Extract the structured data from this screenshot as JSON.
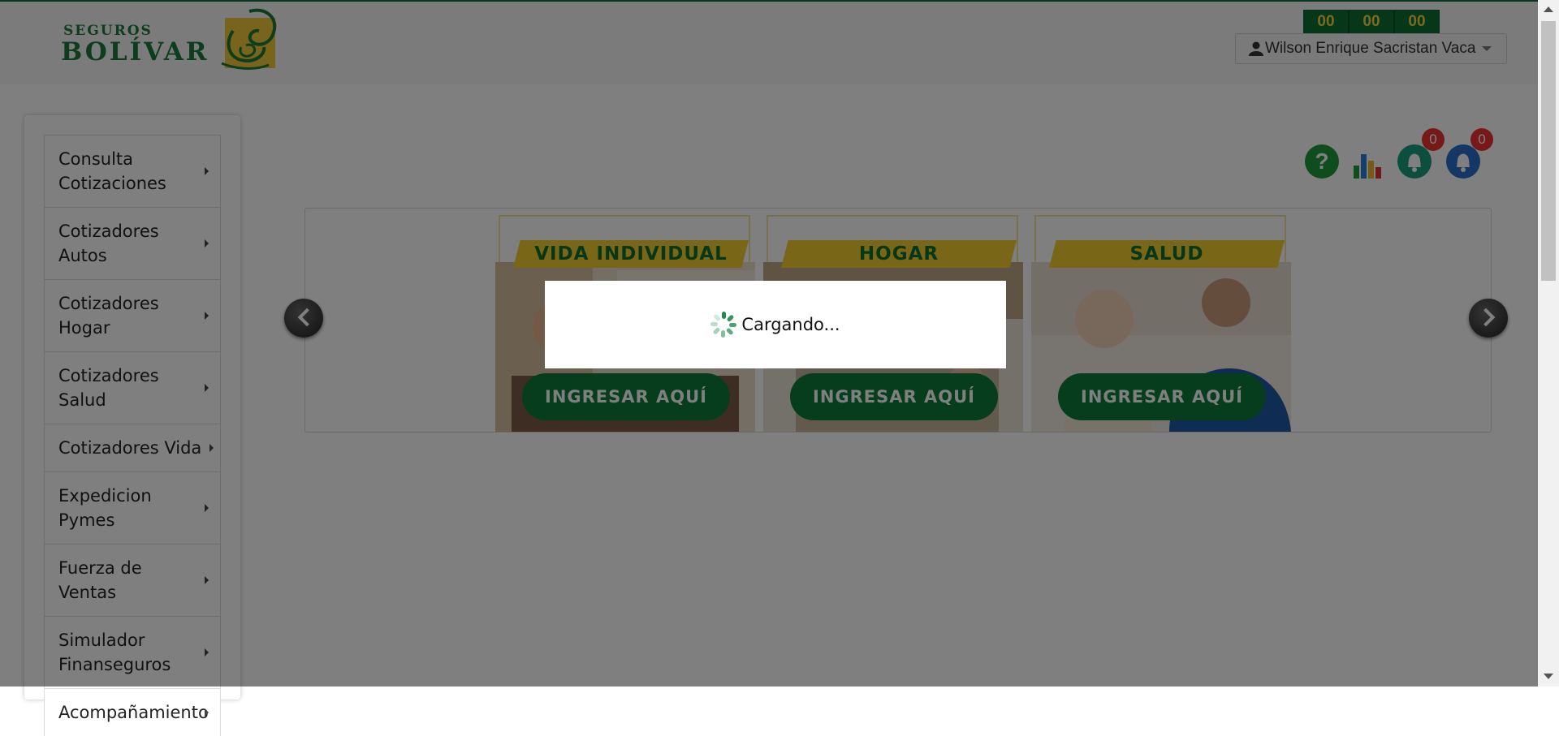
{
  "brand": {
    "line1": "SEGUROS",
    "line2": "BOLÍVAR"
  },
  "timer": [
    "00",
    "00",
    "00"
  ],
  "user": {
    "name": "Wilson Enrique Sacristan Vaca"
  },
  "header_icons": {
    "help": "help-icon",
    "stats": "bar-chart-icon",
    "notifications_green": {
      "icon": "bell-icon",
      "count": "0"
    },
    "notifications_blue": {
      "icon": "bell-icon",
      "count": "0"
    }
  },
  "menu": [
    {
      "line1": "Consulta",
      "line2": "Cotizaciones"
    },
    {
      "line1": "Cotizadores",
      "line2": "Autos"
    },
    {
      "line1": "Cotizadores",
      "line2": "Hogar"
    },
    {
      "line1": "Cotizadores",
      "line2": "Salud"
    },
    {
      "line1": "Cotizadores Vida",
      "line2": ""
    },
    {
      "line1": "Expedicion",
      "line2": "Pymes"
    },
    {
      "line1": "Fuerza de",
      "line2": "Ventas"
    },
    {
      "line1": "Simulador",
      "line2": "Finanseguros"
    },
    {
      "line1": "Acompañamiento",
      "line2": ""
    }
  ],
  "carousel": {
    "cards": [
      {
        "title": "VIDA INDIVIDUAL",
        "cta": "INGRESAR AQUÍ"
      },
      {
        "title": "HOGAR",
        "cta": "INGRESAR AQUÍ"
      },
      {
        "title": "SALUD",
        "cta": "INGRESAR AQUÍ"
      }
    ]
  },
  "loading": {
    "text": "Cargando..."
  },
  "colors": {
    "brand_green": "#0c7a3b",
    "brand_yellow": "#f3cc2e",
    "badge_red": "#e33333"
  }
}
